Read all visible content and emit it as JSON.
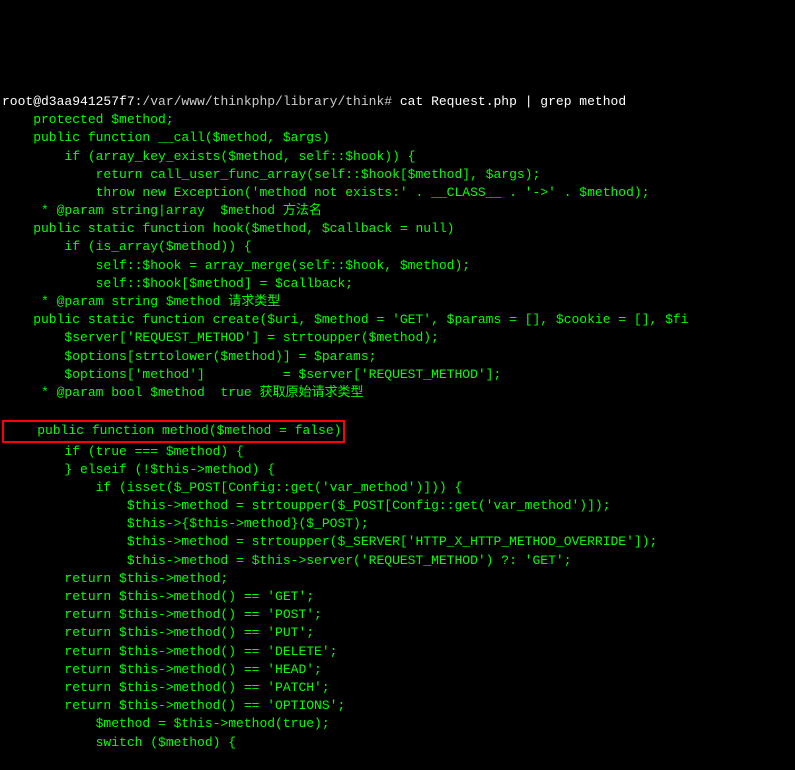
{
  "prompt": {
    "user_host": "root@d3aa941257f7",
    "path": ":/var/www/thinkphp/library/think#",
    "command": " cat Request.php | grep method"
  },
  "lines": [
    "    protected $method;",
    "    public function __call($method, $args)",
    "        if (array_key_exists($method, self::$hook)) {",
    "            return call_user_func_array(self::$hook[$method], $args);",
    "            throw new Exception('method not exists:' . __CLASS__ . '->' . $method);",
    "     * @param string|array  $method 方法名",
    "    public static function hook($method, $callback = null)",
    "        if (is_array($method)) {",
    "            self::$hook = array_merge(self::$hook, $method);",
    "            self::$hook[$method] = $callback;",
    "     * @param string $method 请求类型",
    "    public static function create($uri, $method = 'GET', $params = [], $cookie = [], $fi",
    "        $server['REQUEST_METHOD'] = strtoupper($method);",
    "        $options[strtolower($method)] = $params;",
    "        $options['method']          = $server['REQUEST_METHOD'];",
    "     * @param bool $method  true 获取原始请求类型"
  ],
  "highlighted": "    public function method($method = false)",
  "lines_after": [
    "        if (true === $method) {",
    "        } elseif (!$this->method) {",
    "            if (isset($_POST[Config::get('var_method')])) {",
    "                $this->method = strtoupper($_POST[Config::get('var_method')]);",
    "                $this->{$this->method}($_POST);",
    "                $this->method = strtoupper($_SERVER['HTTP_X_HTTP_METHOD_OVERRIDE']);",
    "                $this->method = $this->server('REQUEST_METHOD') ?: 'GET';",
    "        return $this->method;",
    "        return $this->method() == 'GET';",
    "        return $this->method() == 'POST';",
    "        return $this->method() == 'PUT';",
    "        return $this->method() == 'DELETE';",
    "        return $this->method() == 'HEAD';",
    "        return $this->method() == 'PATCH';",
    "        return $this->method() == 'OPTIONS';",
    "            $method = $this->method(true);",
    "            switch ($method) {"
  ]
}
